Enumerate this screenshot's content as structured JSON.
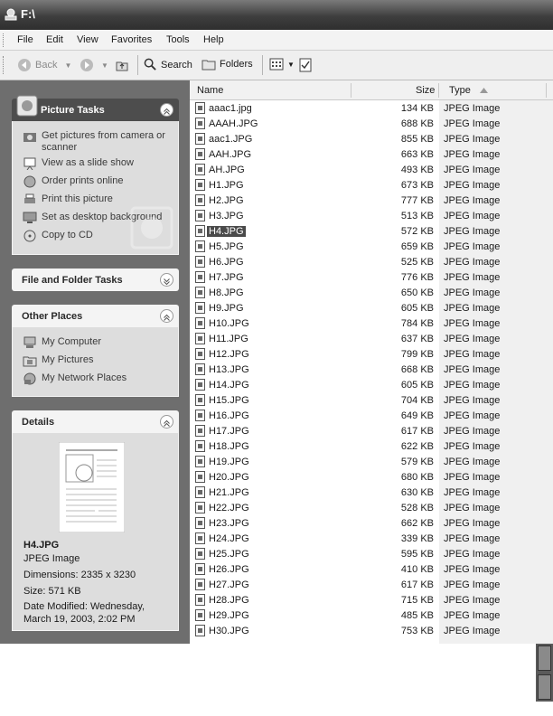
{
  "window": {
    "title": "F:\\"
  },
  "menu": [
    "File",
    "Edit",
    "View",
    "Favorites",
    "Tools",
    "Help"
  ],
  "toolbar": {
    "back": "Back",
    "search": "Search",
    "folders": "Folders"
  },
  "picture_tasks": {
    "title": "Picture Tasks",
    "items": [
      {
        "label": "Get pictures from camera or scanner",
        "icon": "camera-icon"
      },
      {
        "label": "View as a slide show",
        "icon": "slideshow-icon"
      },
      {
        "label": "Order prints online",
        "icon": "globe-icon"
      },
      {
        "label": "Print this picture",
        "icon": "printer-icon"
      },
      {
        "label": "Set as desktop background",
        "icon": "desktop-icon"
      },
      {
        "label": "Copy to CD",
        "icon": "cd-icon"
      }
    ]
  },
  "file_folder_tasks": {
    "title": "File and Folder Tasks"
  },
  "other_places": {
    "title": "Other Places",
    "items": [
      {
        "label": "My Computer",
        "icon": "computer-icon"
      },
      {
        "label": "My Pictures",
        "icon": "pictures-folder-icon"
      },
      {
        "label": "My Network Places",
        "icon": "network-icon"
      }
    ]
  },
  "details": {
    "title": "Details",
    "name": "H4.JPG",
    "type": "JPEG Image",
    "dimensions": "Dimensions: 2335 x 3230",
    "size": "Size: 571 KB",
    "modified_1": "Date Modified: Wednesday,",
    "modified_2": "March 19, 2003, 2:02 PM"
  },
  "columns": {
    "name": "Name",
    "size": "Size",
    "type": "Type"
  },
  "files": [
    {
      "name": "aaac1.jpg",
      "size": "134 KB",
      "type": "JPEG Image"
    },
    {
      "name": "AAAH.JPG",
      "size": "688 KB",
      "type": "JPEG Image"
    },
    {
      "name": "aac1.JPG",
      "size": "855 KB",
      "type": "JPEG Image"
    },
    {
      "name": "AAH.JPG",
      "size": "663 KB",
      "type": "JPEG Image"
    },
    {
      "name": "AH.JPG",
      "size": "493 KB",
      "type": "JPEG Image"
    },
    {
      "name": "H1.JPG",
      "size": "673 KB",
      "type": "JPEG Image"
    },
    {
      "name": "H2.JPG",
      "size": "777 KB",
      "type": "JPEG Image"
    },
    {
      "name": "H3.JPG",
      "size": "513 KB",
      "type": "JPEG Image"
    },
    {
      "name": "H4.JPG",
      "size": "572 KB",
      "type": "JPEG Image",
      "selected": true
    },
    {
      "name": "H5.JPG",
      "size": "659 KB",
      "type": "JPEG Image"
    },
    {
      "name": "H6.JPG",
      "size": "525 KB",
      "type": "JPEG Image"
    },
    {
      "name": "H7.JPG",
      "size": "776 KB",
      "type": "JPEG Image"
    },
    {
      "name": "H8.JPG",
      "size": "650 KB",
      "type": "JPEG Image"
    },
    {
      "name": "H9.JPG",
      "size": "605 KB",
      "type": "JPEG Image"
    },
    {
      "name": "H10.JPG",
      "size": "784 KB",
      "type": "JPEG Image"
    },
    {
      "name": "H11.JPG",
      "size": "637 KB",
      "type": "JPEG Image"
    },
    {
      "name": "H12.JPG",
      "size": "799 KB",
      "type": "JPEG Image"
    },
    {
      "name": "H13.JPG",
      "size": "668 KB",
      "type": "JPEG Image"
    },
    {
      "name": "H14.JPG",
      "size": "605 KB",
      "type": "JPEG Image"
    },
    {
      "name": "H15.JPG",
      "size": "704 KB",
      "type": "JPEG Image"
    },
    {
      "name": "H16.JPG",
      "size": "649 KB",
      "type": "JPEG Image"
    },
    {
      "name": "H17.JPG",
      "size": "617 KB",
      "type": "JPEG Image"
    },
    {
      "name": "H18.JPG",
      "size": "622 KB",
      "type": "JPEG Image"
    },
    {
      "name": "H19.JPG",
      "size": "579 KB",
      "type": "JPEG Image"
    },
    {
      "name": "H20.JPG",
      "size": "680 KB",
      "type": "JPEG Image"
    },
    {
      "name": "H21.JPG",
      "size": "630 KB",
      "type": "JPEG Image"
    },
    {
      "name": "H22.JPG",
      "size": "528 KB",
      "type": "JPEG Image"
    },
    {
      "name": "H23.JPG",
      "size": "662 KB",
      "type": "JPEG Image"
    },
    {
      "name": "H24.JPG",
      "size": "339 KB",
      "type": "JPEG Image"
    },
    {
      "name": "H25.JPG",
      "size": "595 KB",
      "type": "JPEG Image"
    },
    {
      "name": "H26.JPG",
      "size": "410 KB",
      "type": "JPEG Image"
    },
    {
      "name": "H27.JPG",
      "size": "617 KB",
      "type": "JPEG Image"
    },
    {
      "name": "H28.JPG",
      "size": "715 KB",
      "type": "JPEG Image"
    },
    {
      "name": "H29.JPG",
      "size": "485 KB",
      "type": "JPEG Image"
    },
    {
      "name": "H30.JPG",
      "size": "753 KB",
      "type": "JPEG Image"
    }
  ]
}
